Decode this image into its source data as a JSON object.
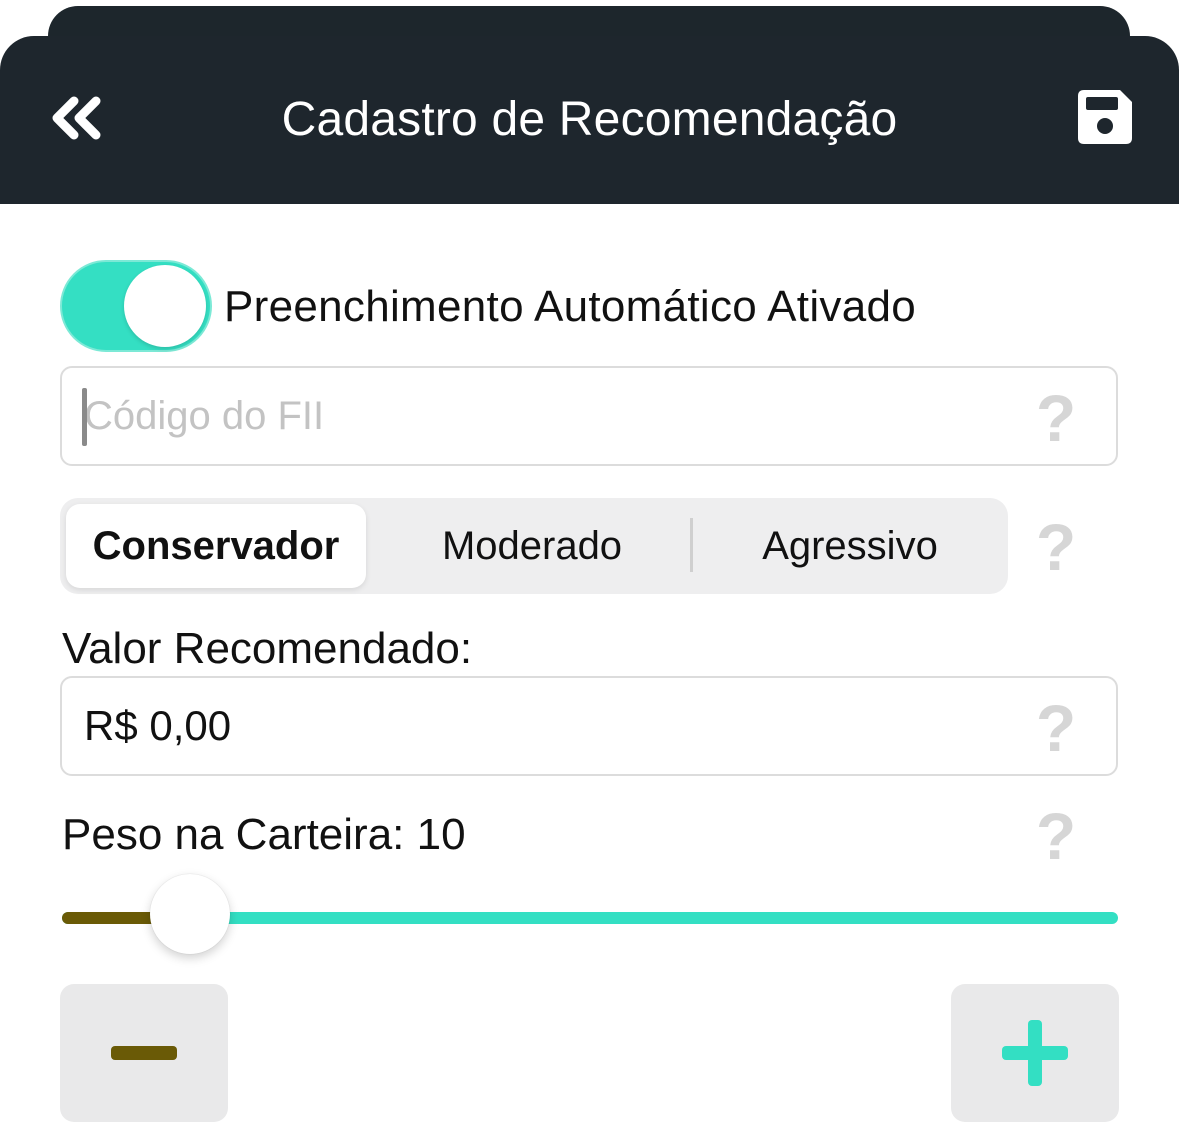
{
  "header": {
    "title": "Cadastro de Recomendação",
    "back_icon": "double-chevron-left-icon",
    "save_icon": "floppy-disk-icon",
    "background": "#1e262d"
  },
  "autofill": {
    "label": "Preenchimento Automático Ativado",
    "enabled": true,
    "color": "#34dfc3"
  },
  "fund_code": {
    "value": "",
    "placeholder": "Código do FII",
    "help": "?"
  },
  "profile": {
    "options": [
      "Conservador",
      "Moderado",
      "Agressivo"
    ],
    "selected": "Conservador",
    "help": "?"
  },
  "recommended_value": {
    "label": "Valor Recomendado:",
    "value": "R$ 0,00",
    "help": "?"
  },
  "portfolio_weight": {
    "label": "Peso na Carteira: 10",
    "value": 10,
    "help": "?",
    "fill_color": "#6a5a06",
    "track_color": "#33dfc3"
  },
  "stepper": {
    "minus_icon": "minus-icon",
    "plus_icon": "plus-icon"
  }
}
